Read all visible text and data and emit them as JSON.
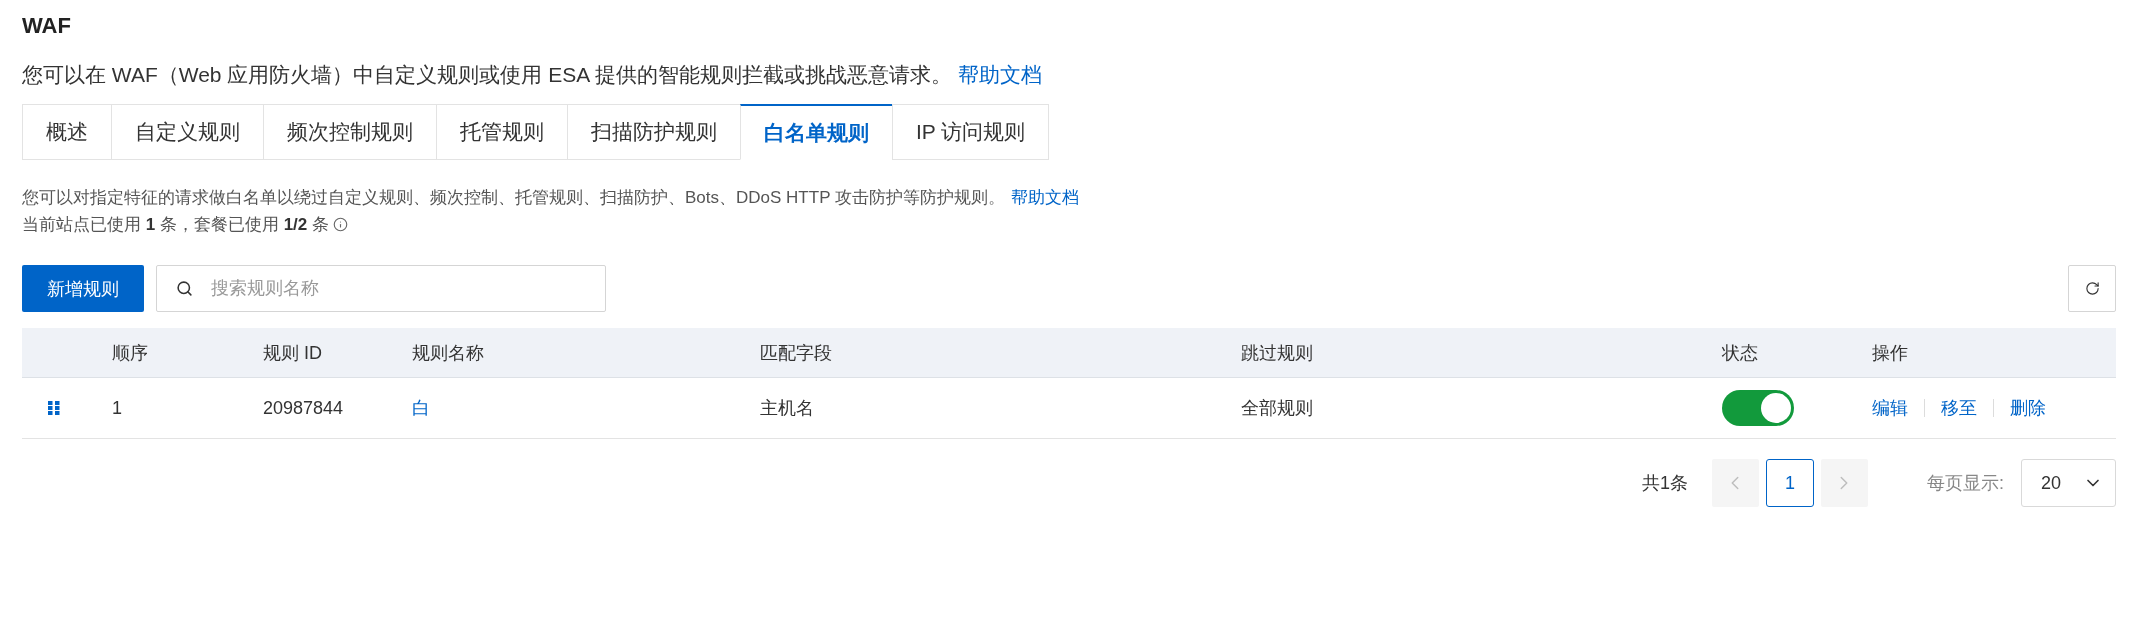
{
  "header": {
    "title": "WAF",
    "description": "您可以在 WAF（Web 应用防火墙）中自定义规则或使用 ESA 提供的智能规则拦截或挑战恶意请求。",
    "help_link": "帮助文档"
  },
  "tabs": [
    {
      "label": "概述",
      "selected": false
    },
    {
      "label": "自定义规则",
      "selected": false
    },
    {
      "label": "频次控制规则",
      "selected": false
    },
    {
      "label": "托管规则",
      "selected": false
    },
    {
      "label": "扫描防护规则",
      "selected": false
    },
    {
      "label": "白名单规则",
      "selected": true
    },
    {
      "label": "IP 访问规则",
      "selected": false
    }
  ],
  "notice": {
    "text": "您可以对指定特征的请求做白名单以绕过自定义规则、频次控制、托管规则、扫描防护、Bots、DDoS HTTP 攻击防护等防护规则。",
    "help_link": "帮助文档",
    "usage": "当前站点已使用 **1** 条，套餐已使用 **1/2** 条"
  },
  "toolbar": {
    "add_button": "新增规则",
    "search": {
      "placeholder": "搜索规则名称"
    }
  },
  "table": {
    "columns": [
      "顺序",
      "规则 ID",
      "规则名称",
      "匹配字段",
      "跳过规则",
      "状态",
      "操作"
    ],
    "rows": [
      {
        "order": "1",
        "rule_id": "20987844",
        "name": "白",
        "match_field": "主机名",
        "skip_rules": "全部规则",
        "enabled": true,
        "actions": [
          "编辑",
          "移至",
          "删除"
        ]
      }
    ]
  },
  "pagination": {
    "total": "共1条",
    "prev_disabled": true,
    "pages": [
      {
        "label": "1",
        "selected": true
      }
    ],
    "next_disabled": true,
    "page_size_label": "每页显示:",
    "page_size": "20"
  }
}
